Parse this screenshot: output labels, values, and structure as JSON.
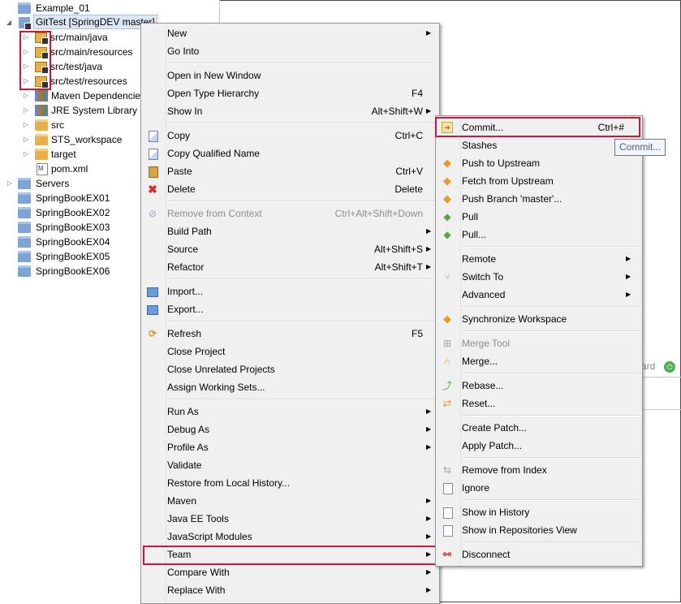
{
  "tree": {
    "items": [
      {
        "label": "Example_01",
        "icon": "folder-icon",
        "twisty": ""
      },
      {
        "label": "GitTest [SpringDEV master]",
        "icon": "project-icon",
        "twisty": "◢"
      },
      {
        "label": "src/main/java",
        "icon": "package-icon",
        "twisty": "▷"
      },
      {
        "label": "src/main/resources",
        "icon": "package-icon",
        "twisty": "▷"
      },
      {
        "label": "src/test/java",
        "icon": "package-icon",
        "twisty": "▷"
      },
      {
        "label": "src/test/resources",
        "icon": "package-icon",
        "twisty": "▷"
      },
      {
        "label": "Maven Dependencies",
        "icon": "library-icon",
        "twisty": "▷"
      },
      {
        "label": "JRE System Library [",
        "icon": "library-icon",
        "twisty": "▷"
      },
      {
        "label": "src",
        "icon": "source-folder-icon",
        "twisty": "▷"
      },
      {
        "label": "STS_workspace",
        "icon": "source-folder-icon",
        "twisty": "▷"
      },
      {
        "label": "target",
        "icon": "source-folder-icon",
        "twisty": "▷"
      },
      {
        "label": "pom.xml",
        "icon": "xml-file-icon",
        "twisty": ""
      },
      {
        "label": "Servers",
        "icon": "folder-icon",
        "twisty": "▷"
      },
      {
        "label": "SpringBookEX01",
        "icon": "folder-icon",
        "twisty": ""
      },
      {
        "label": "SpringBookEX02",
        "icon": "folder-icon",
        "twisty": ""
      },
      {
        "label": "SpringBookEX03",
        "icon": "folder-icon",
        "twisty": ""
      },
      {
        "label": "SpringBookEX04",
        "icon": "folder-icon",
        "twisty": ""
      },
      {
        "label": "SpringBookEX05",
        "icon": "folder-icon",
        "twisty": ""
      },
      {
        "label": "SpringBookEX06",
        "icon": "folder-icon",
        "twisty": ""
      }
    ]
  },
  "context_menu": {
    "items": [
      {
        "label": "New",
        "shortcut": "",
        "arrow": "▶",
        "icon": ""
      },
      {
        "label": "Go Into",
        "shortcut": "",
        "arrow": "",
        "icon": ""
      },
      {
        "label": "Open in New Window",
        "shortcut": "",
        "arrow": "",
        "icon": ""
      },
      {
        "label": "Open Type Hierarchy",
        "shortcut": "F4",
        "arrow": "",
        "icon": ""
      },
      {
        "label": "Show In",
        "shortcut": "Alt+Shift+W",
        "arrow": "▶",
        "icon": ""
      },
      {
        "label": "Copy",
        "shortcut": "Ctrl+C",
        "arrow": "",
        "icon": "copy-icon"
      },
      {
        "label": "Copy Qualified Name",
        "shortcut": "",
        "arrow": "",
        "icon": "copy-icon"
      },
      {
        "label": "Paste",
        "shortcut": "Ctrl+V",
        "arrow": "",
        "icon": "paste-icon"
      },
      {
        "label": "Delete",
        "shortcut": "Delete",
        "arrow": "",
        "icon": "delete-icon"
      },
      {
        "label": "Remove from Context",
        "shortcut": "Ctrl+Alt+Shift+Down",
        "arrow": "",
        "icon": "context-icon",
        "disabled": true
      },
      {
        "label": "Build Path",
        "shortcut": "",
        "arrow": "▶",
        "icon": ""
      },
      {
        "label": "Source",
        "shortcut": "Alt+Shift+S",
        "arrow": "▶",
        "icon": ""
      },
      {
        "label": "Refactor",
        "shortcut": "Alt+Shift+T",
        "arrow": "▶",
        "icon": ""
      },
      {
        "label": "Import...",
        "shortcut": "",
        "arrow": "",
        "icon": "import-icon"
      },
      {
        "label": "Export...",
        "shortcut": "",
        "arrow": "",
        "icon": "export-icon"
      },
      {
        "label": "Refresh",
        "shortcut": "F5",
        "arrow": "",
        "icon": "refresh-icon"
      },
      {
        "label": "Close Project",
        "shortcut": "",
        "arrow": "",
        "icon": ""
      },
      {
        "label": "Close Unrelated Projects",
        "shortcut": "",
        "arrow": "",
        "icon": ""
      },
      {
        "label": "Assign Working Sets...",
        "shortcut": "",
        "arrow": "",
        "icon": ""
      },
      {
        "label": "Run As",
        "shortcut": "",
        "arrow": "▶",
        "icon": ""
      },
      {
        "label": "Debug As",
        "shortcut": "",
        "arrow": "▶",
        "icon": ""
      },
      {
        "label": "Profile As",
        "shortcut": "",
        "arrow": "▶",
        "icon": ""
      },
      {
        "label": "Validate",
        "shortcut": "",
        "arrow": "",
        "icon": ""
      },
      {
        "label": "Restore from Local History...",
        "shortcut": "",
        "arrow": "",
        "icon": ""
      },
      {
        "label": "Maven",
        "shortcut": "",
        "arrow": "▶",
        "icon": ""
      },
      {
        "label": "Java EE Tools",
        "shortcut": "",
        "arrow": "▶",
        "icon": ""
      },
      {
        "label": "JavaScript Modules",
        "shortcut": "",
        "arrow": "▶",
        "icon": ""
      },
      {
        "label": "Team",
        "shortcut": "",
        "arrow": "▶",
        "icon": ""
      },
      {
        "label": "Compare With",
        "shortcut": "",
        "arrow": "▶",
        "icon": ""
      },
      {
        "label": "Replace With",
        "shortcut": "",
        "arrow": "▶",
        "icon": ""
      }
    ]
  },
  "team_menu": {
    "items": [
      {
        "label": "Commit...",
        "shortcut": "Ctrl+#",
        "arrow": "",
        "icon": "commit-icon"
      },
      {
        "label": "Stashes",
        "shortcut": "",
        "arrow": "",
        "icon": ""
      },
      {
        "label": "Push to Upstream",
        "shortcut": "",
        "arrow": "",
        "icon": "push-icon"
      },
      {
        "label": "Fetch from Upstream",
        "shortcut": "",
        "arrow": "",
        "icon": "fetch-icon"
      },
      {
        "label": "Push Branch 'master'...",
        "shortcut": "",
        "arrow": "",
        "icon": "push-icon"
      },
      {
        "label": "Pull",
        "shortcut": "",
        "arrow": "",
        "icon": "pull-icon"
      },
      {
        "label": "Pull...",
        "shortcut": "",
        "arrow": "",
        "icon": "pull-icon"
      },
      {
        "label": "Remote",
        "shortcut": "",
        "arrow": "▶",
        "icon": ""
      },
      {
        "label": "Switch To",
        "shortcut": "",
        "arrow": "▶",
        "icon": "switch-icon"
      },
      {
        "label": "Advanced",
        "shortcut": "",
        "arrow": "▶",
        "icon": ""
      },
      {
        "label": "Synchronize Workspace",
        "shortcut": "",
        "arrow": "",
        "icon": "synchronize-icon"
      },
      {
        "label": "Merge Tool",
        "shortcut": "",
        "arrow": "",
        "icon": "merge-tool-icon",
        "disabled": true
      },
      {
        "label": "Merge...",
        "shortcut": "",
        "arrow": "",
        "icon": "merge-icon"
      },
      {
        "label": "Rebase...",
        "shortcut": "",
        "arrow": "",
        "icon": "rebase-icon"
      },
      {
        "label": "Reset...",
        "shortcut": "",
        "arrow": "",
        "icon": "reset-icon"
      },
      {
        "label": "Create Patch...",
        "shortcut": "",
        "arrow": "",
        "icon": ""
      },
      {
        "label": "Apply Patch...",
        "shortcut": "",
        "arrow": "",
        "icon": ""
      },
      {
        "label": "Remove from Index",
        "shortcut": "",
        "arrow": "",
        "icon": "remove-index-icon"
      },
      {
        "label": "Ignore",
        "shortcut": "",
        "arrow": "",
        "icon": "ignore-icon"
      },
      {
        "label": "Show in History",
        "shortcut": "",
        "arrow": "",
        "icon": "history-icon"
      },
      {
        "label": "Show in Repositories View",
        "shortcut": "",
        "arrow": "",
        "icon": "repositories-icon"
      },
      {
        "label": "Disconnect",
        "shortcut": "",
        "arrow": "",
        "icon": "disconnect-icon"
      }
    ]
  },
  "tooltip": {
    "text": "Commit..."
  },
  "background": {
    "partial_text": "ard"
  },
  "colors": {
    "highlight": "#d2143a",
    "menu_bg": "#f0f0f0",
    "disabled_text": "#8d8d8d"
  }
}
